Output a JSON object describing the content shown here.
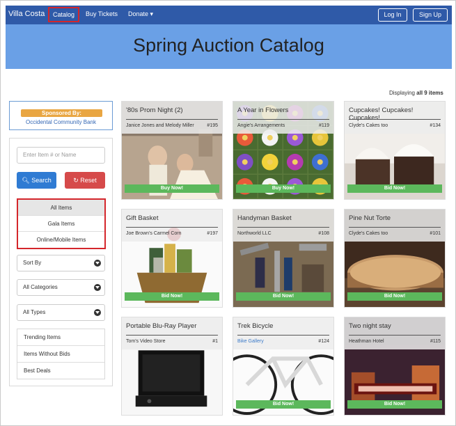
{
  "nav": {
    "brand": "Villa Costa",
    "catalog": "Catalog",
    "buy_tickets": "Buy Tickets",
    "donate": "Donate ▾",
    "login": "Log In",
    "signup": "Sign Up"
  },
  "hero": {
    "title": "Spring Auction Catalog"
  },
  "sidebar": {
    "sponsor_label": "Sponsored By:",
    "sponsor_name": "Occidental Community Bank",
    "search_placeholder": "Enter Item # or Name",
    "search_button": "Search",
    "reset_button": "Reset",
    "item_types": [
      "All Items",
      "Gala Items",
      "Online/Mobile Items"
    ],
    "sort_by": "Sort By",
    "categories": "All Categories",
    "types": "All Types",
    "quick_links": [
      "Trending Items",
      "Items Without Bids",
      "Best Deals"
    ]
  },
  "main": {
    "count_prefix": "Displaying ",
    "count_value": "all 9 items"
  },
  "cards": [
    {
      "title": "'80s Prom Night (2)",
      "donor": "Janice Jones and Melody Miller",
      "number": "#195",
      "action": "Buy Now!",
      "img": "prom"
    },
    {
      "title": "A Year in Flowers",
      "donor": "Angie's Arrangements",
      "number": "#119",
      "action": "Buy Now!",
      "img": "flowers"
    },
    {
      "title": "Cupcakes! Cupcakes! Cupcakes!",
      "donor": "Clyde's Cakes too",
      "number": "#134",
      "action": "Bid Now!",
      "img": "cupcakes"
    },
    {
      "title": "Gift Basket",
      "donor": "Joe Brown's Carmel Corn",
      "number": "#197",
      "action": "Bid Now!",
      "img": "basket"
    },
    {
      "title": "Handyman Basket",
      "donor": "Northworld LLC",
      "number": "#108",
      "action": "Bid Now!",
      "img": "tools"
    },
    {
      "title": "Pine Nut Torte",
      "donor": "Clyde's Cakes too",
      "number": "#101",
      "action": "Bid Now!",
      "img": "torte"
    },
    {
      "title": "Portable Blu-Ray Player",
      "donor": "Tom's Video Store",
      "number": "#1",
      "action": "",
      "img": "bluray"
    },
    {
      "title": "Trek Bicycle",
      "donor": "Bike Gallery",
      "number": "#124",
      "action": "Bid Now!",
      "img": "bike",
      "donor_link": true
    },
    {
      "title": "Two night stay",
      "donor": "Heathman Hotel",
      "number": "#115",
      "action": "Bid Now!",
      "img": "hotel"
    }
  ],
  "colors": {
    "nav": "#2f5aa8",
    "hero": "#6aa0e6",
    "bid": "#5cb85c",
    "highlight": "#d4262b"
  }
}
